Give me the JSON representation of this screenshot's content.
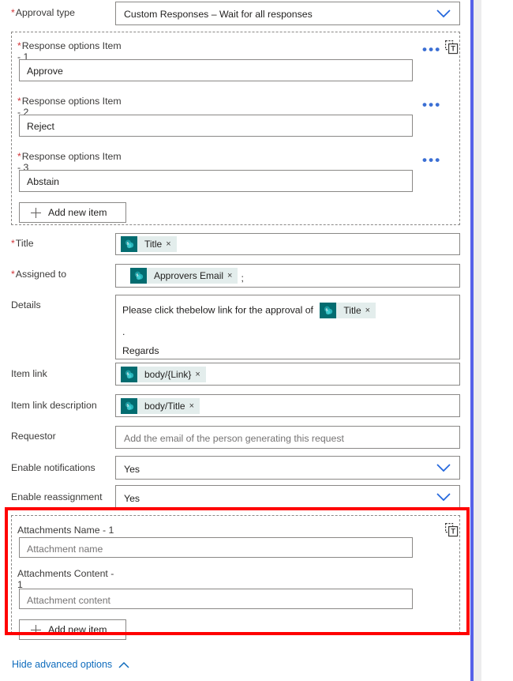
{
  "panel": {
    "accent_color": "#5561e8",
    "highlight_color": "#ff0000",
    "token_chip_icon_color": "#036c70",
    "token_chip_bg_color": "#e3edec",
    "link_color": "#0f6cbd"
  },
  "approval_type": {
    "label": "Approval type",
    "required_marker": "*",
    "value": "Custom Responses – Wait for all responses",
    "chevron_icon": "chevron-down-icon"
  },
  "response_options": {
    "add_button_label": "Add new item",
    "add_button_icon": "plus-icon",
    "items": [
      {
        "label": "Response options Item - 1",
        "label_main": "Response options Item",
        "label_suffix": "- 1",
        "required_marker": "*",
        "value": "Approve",
        "overflow_icon": "ellipsis-icon",
        "overflow_label": "•••",
        "token_icon": "insert-token-icon"
      },
      {
        "label": "Response options Item - 2",
        "label_main": "Response options Item",
        "label_suffix": "- 2",
        "required_marker": "*",
        "value": "Reject",
        "overflow_icon": "ellipsis-icon",
        "overflow_label": "•••"
      },
      {
        "label": "Response options Item - 3",
        "label_main": "Response options Item",
        "label_suffix": "- 3",
        "required_marker": "*",
        "value": "Abstain",
        "overflow_icon": "ellipsis-icon",
        "overflow_label": "•••"
      }
    ]
  },
  "title_field": {
    "label": "Title",
    "required_marker": "*",
    "chip": {
      "text": "Title",
      "remove": "×",
      "icon": "sharepoint-icon"
    }
  },
  "assigned_to_field": {
    "label": "Assigned to",
    "required_marker": "*",
    "chip": {
      "text": "Approvers Email",
      "remove": "×",
      "icon": "sharepoint-icon"
    },
    "trailing_text": ";"
  },
  "details_field": {
    "label": "Details",
    "line1_before": "Please click thebelow  link for the approval of",
    "chip": {
      "text": "Title",
      "remove": "×",
      "icon": "sharepoint-icon"
    },
    "line2": ".",
    "line3": "Regards"
  },
  "item_link_field": {
    "label": "Item link",
    "chip": {
      "text": "body/{Link}",
      "remove": "×",
      "icon": "sharepoint-icon"
    }
  },
  "item_link_description_field": {
    "label": "Item link description",
    "chip": {
      "text": "body/Title",
      "remove": "×",
      "icon": "sharepoint-icon"
    }
  },
  "requestor_field": {
    "label": "Requestor",
    "value": "",
    "placeholder": "Add the email of the person generating this request"
  },
  "enable_notifications_field": {
    "label": "Enable notifications",
    "value": "Yes",
    "chevron_icon": "chevron-down-icon"
  },
  "enable_reassignment_field": {
    "label": "Enable reassignment",
    "value": "Yes",
    "chevron_icon": "chevron-down-icon"
  },
  "attachments": {
    "name_label": "Attachments Name - 1",
    "name_label_main": "Attachments Name - 1",
    "name_placeholder": "Attachment name",
    "name_value": "",
    "content_label_main": "Attachments Content -",
    "content_label_suffix": "1",
    "content_placeholder": "Attachment content",
    "content_value": "",
    "token_icon": "insert-token-icon",
    "add_button_label": "Add new item",
    "add_button_icon": "plus-icon"
  },
  "footer": {
    "hide_advanced_label": "Hide advanced options",
    "caret_icon": "chevron-up-icon"
  }
}
